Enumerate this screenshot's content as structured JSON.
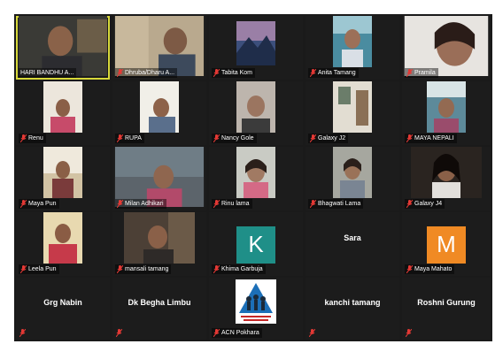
{
  "colors": {
    "background": "#1a1a1a",
    "tile": "#1c1c1c",
    "active_outline": "#d7d83a",
    "muted_mic": "#e53935",
    "avatar_k": "#1f8f88",
    "avatar_m": "#f08a24"
  },
  "tiles": [
    {
      "name": "HARI BANDHU A..."
    },
    {
      "name": "Dhruba/Dharu A..."
    },
    {
      "name": "Tabita Kom"
    },
    {
      "name": "Anita Tamang"
    },
    {
      "name": "Pramila"
    },
    {
      "name": "Renu"
    },
    {
      "name": "RUPA"
    },
    {
      "name": "Nancy Gole"
    },
    {
      "name": "Galaxy J2"
    },
    {
      "name": "MAYA NEPALI"
    },
    {
      "name": "Maya Pun"
    },
    {
      "name": "Milan Adhikari"
    },
    {
      "name": "Rinu lama"
    },
    {
      "name": "Bhagwati Lama"
    },
    {
      "name": "Galaxy J4"
    },
    {
      "name": "Leela Pun"
    },
    {
      "name": "mansali tamang"
    },
    {
      "name": "Khima Garbuja",
      "avatar_letter": "K"
    },
    {
      "name": "Sara"
    },
    {
      "name": "Maya Mahato",
      "avatar_letter": "M"
    },
    {
      "name": "Grg Nabin"
    },
    {
      "name": "Dk Begha Limbu"
    },
    {
      "name": "ACN Pokhara"
    },
    {
      "name": "kanchi tamang"
    },
    {
      "name": "Roshni Gurung"
    }
  ]
}
